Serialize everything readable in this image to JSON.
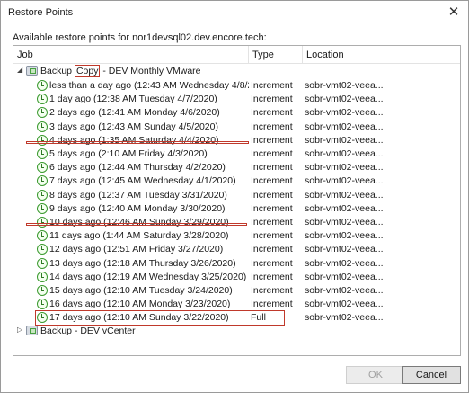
{
  "window": {
    "title": "Restore Points",
    "close_glyph": "✕"
  },
  "subtitle": "Available restore points for nor1devsql02.dev.encore.tech:",
  "columns": {
    "job": "Job",
    "type": "Type",
    "location": "Location"
  },
  "group1": {
    "expander": "◢",
    "label_before": "Backup ",
    "label_highlight": "Copy",
    "label_after": " - DEV Monthly VMware"
  },
  "rows": [
    {
      "job": "less than a day ago (12:43 AM Wednesday 4/8/20...",
      "type": "Increment",
      "location": "sobr-vmt02-veea..."
    },
    {
      "job": "1 day ago (12:38 AM Tuesday 4/7/2020)",
      "type": "Increment",
      "location": "sobr-vmt02-veea..."
    },
    {
      "job": "2 days ago (12:41 AM Monday 4/6/2020)",
      "type": "Increment",
      "location": "sobr-vmt02-veea..."
    },
    {
      "job": "3 days ago (12:43 AM Sunday 4/5/2020)",
      "type": "Increment",
      "location": "sobr-vmt02-veea..."
    },
    {
      "job": "4 days ago (1:35 AM Saturday 4/4/2020)",
      "type": "Increment",
      "location": "sobr-vmt02-veea..."
    },
    {
      "job": "5 days ago (2:10 AM Friday 4/3/2020)",
      "type": "Increment",
      "location": "sobr-vmt02-veea..."
    },
    {
      "job": "6 days ago (12:44 AM Thursday 4/2/2020)",
      "type": "Increment",
      "location": "sobr-vmt02-veea..."
    },
    {
      "job": "7 days ago (12:45 AM Wednesday 4/1/2020)",
      "type": "Increment",
      "location": "sobr-vmt02-veea..."
    },
    {
      "job": "8 days ago (12:37 AM Tuesday 3/31/2020)",
      "type": "Increment",
      "location": "sobr-vmt02-veea..."
    },
    {
      "job": "9 days ago (12:40 AM Monday 3/30/2020)",
      "type": "Increment",
      "location": "sobr-vmt02-veea..."
    },
    {
      "job": "10 days ago (12:46 AM Sunday 3/29/2020)",
      "type": "Increment",
      "location": "sobr-vmt02-veea..."
    },
    {
      "job": "11 days ago (1:44 AM Saturday 3/28/2020)",
      "type": "Increment",
      "location": "sobr-vmt02-veea..."
    },
    {
      "job": "12 days ago (12:51 AM Friday 3/27/2020)",
      "type": "Increment",
      "location": "sobr-vmt02-veea..."
    },
    {
      "job": "13 days ago (12:18 AM Thursday 3/26/2020)",
      "type": "Increment",
      "location": "sobr-vmt02-veea..."
    },
    {
      "job": "14 days ago (12:19 AM Wednesday 3/25/2020)",
      "type": "Increment",
      "location": "sobr-vmt02-veea..."
    },
    {
      "job": "15 days ago (12:10 AM Tuesday 3/24/2020)",
      "type": "Increment",
      "location": "sobr-vmt02-veea..."
    },
    {
      "job": "16 days ago (12:10 AM Monday 3/23/2020)",
      "type": "Increment",
      "location": "sobr-vmt02-veea..."
    },
    {
      "job": "17 days ago (12:10 AM Sunday 3/22/2020)",
      "type": "Full",
      "location": "sobr-vmt02-veea..."
    }
  ],
  "group2": {
    "expander": "▷",
    "label": "Backup - DEV vCenter"
  },
  "buttons": {
    "ok": "OK",
    "cancel": "Cancel"
  },
  "colors": {
    "annotation_red": "#c0392b",
    "clock_green": "#3a9a2e"
  }
}
